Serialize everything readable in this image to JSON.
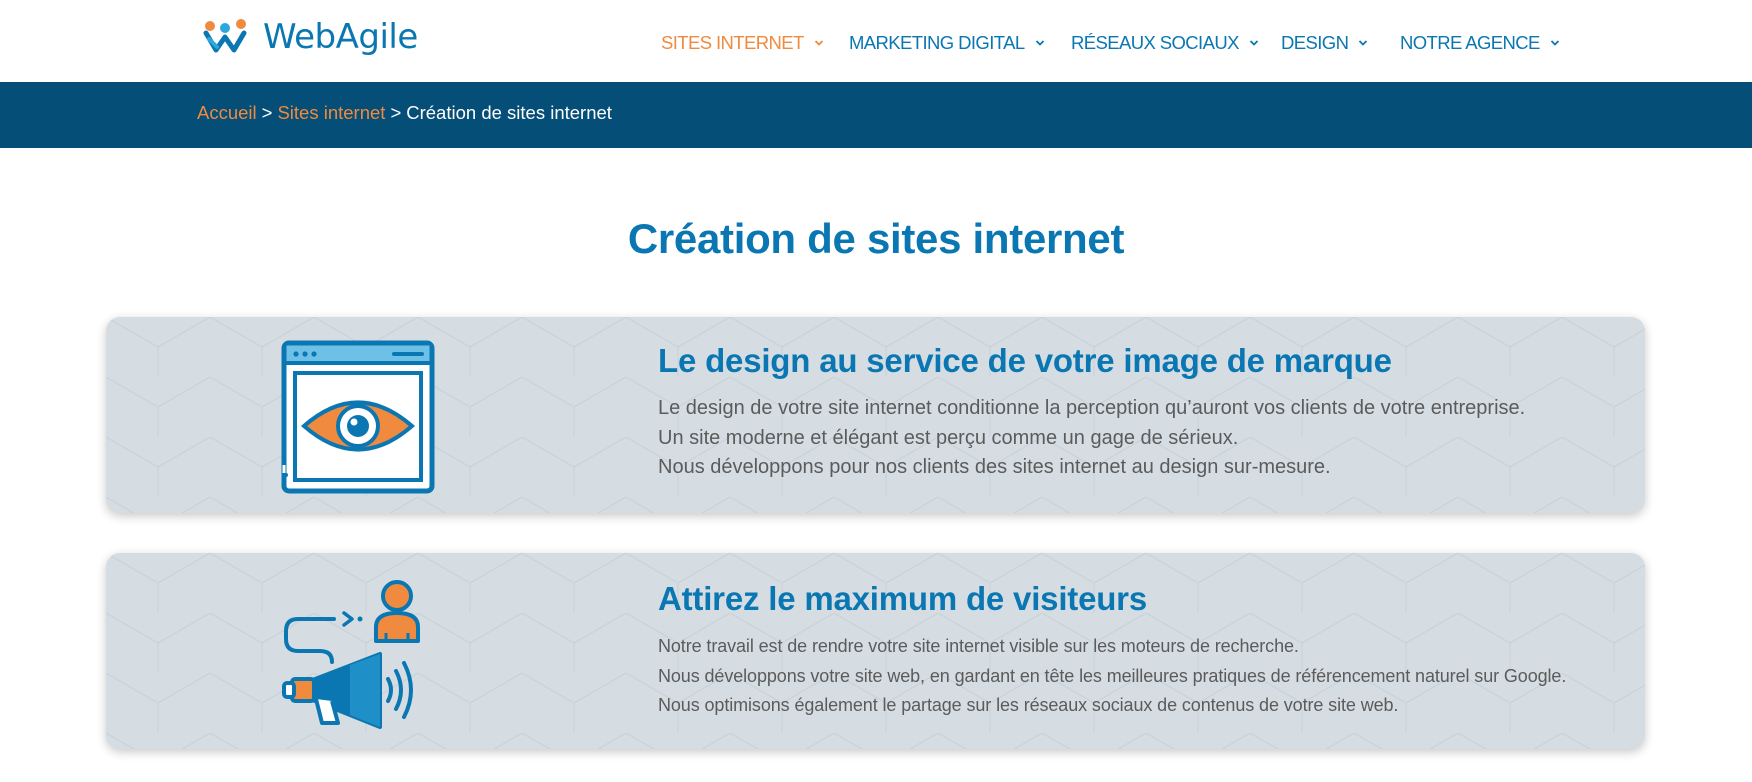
{
  "logo": {
    "text": "WebAgile",
    "icon": "webagile-logo-icon"
  },
  "nav": [
    {
      "label": "SITES INTERNET",
      "active": true
    },
    {
      "label": "MARKETING DIGITAL",
      "active": false
    },
    {
      "label": "RÉSEAUX SOCIAUX",
      "active": false
    },
    {
      "label": "DESIGN",
      "active": false
    },
    {
      "label": "NOTRE AGENCE",
      "active": false
    }
  ],
  "breadcrumb": {
    "home": "Accueil",
    "separator": ">",
    "section": "Sites internet",
    "current": "Création de sites internet"
  },
  "page_title": "Création de sites internet",
  "cards": [
    {
      "icon": "browser-eye-icon",
      "title": "Le design au service de votre image de marque",
      "lines": [
        "Le design de votre site internet conditionne la perception qu’auront vos clients de votre entreprise.",
        "Un site moderne et élégant est perçu comme un gage de sérieux.",
        "Nous développons pour nos clients des sites internet au design sur-mesure."
      ]
    },
    {
      "icon": "megaphone-user-icon",
      "title": "Attirez le maximum de visiteurs",
      "lines": [
        "Notre travail est de rendre votre site internet visible sur les moteurs de recherche.",
        "Nous développons votre site web, en gardant en tête les meilleures pratiques de référencement naturel sur Google.",
        "Nous optimisons également le partage sur les réseaux sociaux de contenus de votre site web."
      ]
    }
  ],
  "colors": {
    "brand_blue": "#0a77b2",
    "accent_orange": "#f08a3e",
    "breadcrumb_bar": "#044e78",
    "card_bg": "#d5dde3",
    "body_text": "#5b5b5b"
  }
}
